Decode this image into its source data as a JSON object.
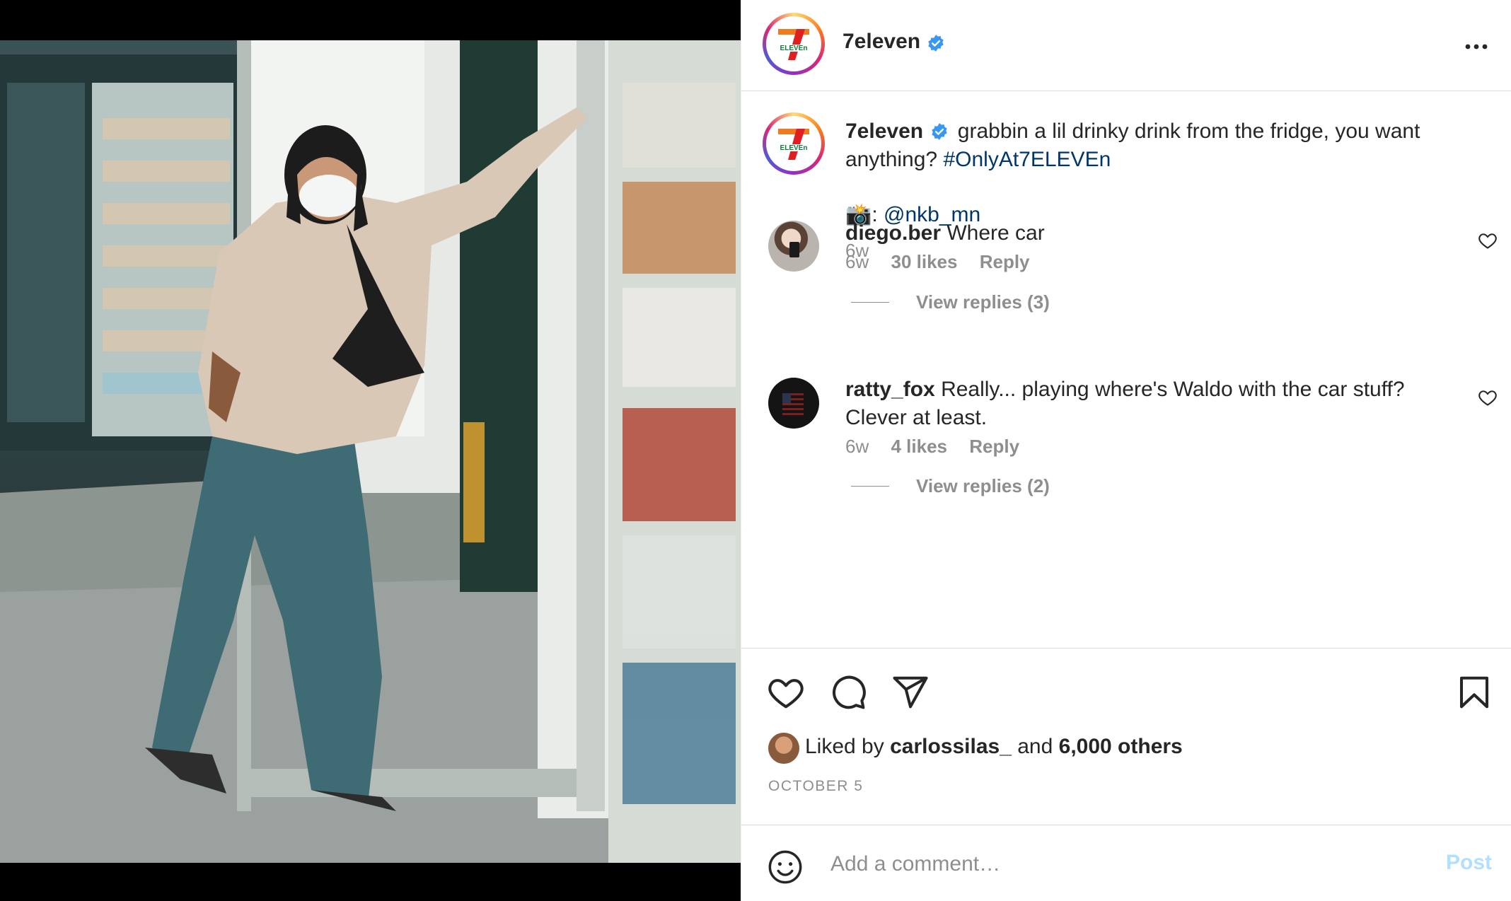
{
  "colors": {
    "accent_blue": "#0095f6",
    "link_blue": "#00376b",
    "verified_blue": "#3897f0",
    "muted_text": "#8e8e8e",
    "post_disabled": "#b2dffc"
  },
  "media": {
    "icon": "photo-of-person-at-store-fridge"
  },
  "header": {
    "username": "7eleven",
    "verified_icon": "verified-badge-icon",
    "more_icon": "ellipsis-icon"
  },
  "caption": {
    "username": "7eleven",
    "text": "grabbin a lil drinky drink from the fridge, you want anything?",
    "hashtag": "#OnlyAt7ELEVEn",
    "credit_emoji": "📸:",
    "credit_handle": "@nkb_mn",
    "time": "6w"
  },
  "comments": [
    {
      "username": "diego.ber",
      "text": "Where car",
      "time": "6w",
      "likes": "30 likes",
      "reply_label": "Reply",
      "view_replies": "View replies (3)"
    },
    {
      "username": "ratty_fox",
      "text": "Really... playing where's Waldo with the car stuff? Clever at least.",
      "time": "6w",
      "likes": "4 likes",
      "reply_label": "Reply",
      "view_replies": "View replies (2)"
    }
  ],
  "actions": {
    "like_icon": "heart-icon",
    "comment_icon": "comment-bubble-icon",
    "share_icon": "paper-plane-icon",
    "save_icon": "bookmark-icon",
    "liked_by_prefix": "Liked by",
    "liked_by_user": "carlossilas_",
    "liked_by_and": "and",
    "liked_by_others": "6,000 others",
    "date": "OCTOBER 5"
  },
  "add_comment": {
    "emoji_icon": "smiley-icon",
    "placeholder": "Add a comment…",
    "post_label": "Post"
  }
}
